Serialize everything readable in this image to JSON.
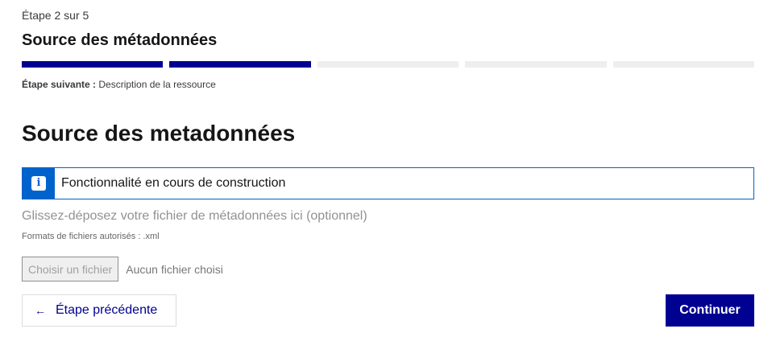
{
  "stepper": {
    "counter": "Étape 2 sur 5",
    "title": "Source des métadonnées",
    "total_steps": 5,
    "completed_steps": 2,
    "next_label": "Étape suivante :",
    "next_value": "Description de la ressource"
  },
  "page": {
    "heading": "Source des metadonnées"
  },
  "notice": {
    "icon": "info-icon",
    "icon_glyph": "i",
    "text": "Fonctionnalité en cours de construction"
  },
  "upload": {
    "label": "Glissez-déposez votre fichier de métadonnées ici (optionnel)",
    "hint": "Formats de fichiers autorisés : .xml",
    "button_label": "Choisir un fichier",
    "status": "Aucun fichier choisi"
  },
  "actions": {
    "prev_icon": "arrow-left-icon",
    "prev_label": "Étape précédente",
    "next_label": "Continuer"
  },
  "colors": {
    "primary": "#000091",
    "info": "#0063cb",
    "bar_inactive": "#eeeeee"
  }
}
